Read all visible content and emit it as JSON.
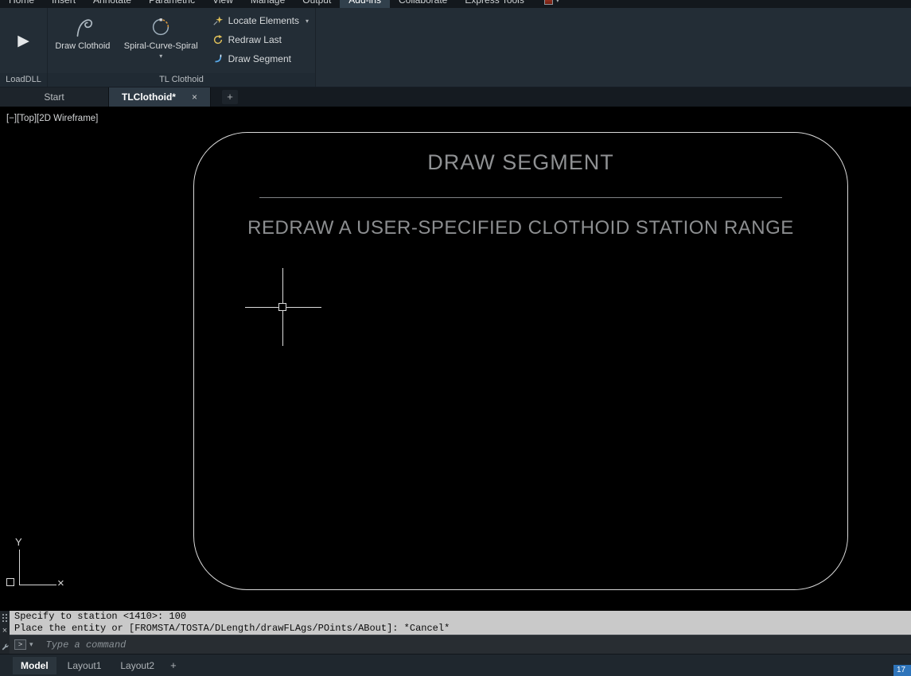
{
  "icons": {
    "play": "▶",
    "chevron_down": "▾",
    "close": "×",
    "plus": "+"
  },
  "menu": {
    "tabs": [
      {
        "label": "Home"
      },
      {
        "label": "Insert"
      },
      {
        "label": "Annotate"
      },
      {
        "label": "Parametric"
      },
      {
        "label": "View"
      },
      {
        "label": "Manage"
      },
      {
        "label": "Output"
      },
      {
        "label": "Add-ins"
      },
      {
        "label": "Collaborate"
      },
      {
        "label": "Express Tools"
      }
    ]
  },
  "ribbon": {
    "panels": [
      {
        "label": "LoadDLL"
      },
      {
        "label": "TL Clothoid"
      }
    ],
    "buttons": {
      "draw_clothoid": "Draw Clothoid",
      "spiral_curve_spiral": "Spiral-Curve-Spiral",
      "locate_elements": "Locate Elements",
      "redraw_last": "Redraw Last",
      "draw_segment": "Draw Segment"
    }
  },
  "file_tabs": {
    "start": "Start",
    "active": "TLClothoid*"
  },
  "viewport": {
    "controls": {
      "collapse": "[−]",
      "view": "[Top]",
      "visual_style": "[2D Wireframe]"
    },
    "ucs": {
      "y_label": "Y",
      "x_label": "×"
    }
  },
  "overlay": {
    "title": "DRAW SEGMENT",
    "subtitle": "REDRAW A USER-SPECIFIED CLOTHOID STATION RANGE"
  },
  "command": {
    "history": [
      "Specify to station <1410>: 100",
      "Place the entity or [FROMSTA/TOSTA/DLength/drawFLAgs/POints/ABout]: *Cancel*"
    ],
    "prompt_glyph": ">",
    "placeholder": "Type a command"
  },
  "status": {
    "model": "Model",
    "layout1": "Layout1",
    "layout2": "Layout2",
    "new_layout": "+",
    "tray_value": "17"
  },
  "colors": {
    "ribbon_bg": "#232d36",
    "canvas_bg": "#000000",
    "history_bg": "#c9c9c9",
    "accent_blue": "#2e74ba",
    "icon_yellow": "#e3c25a",
    "icon_blue": "#58a8e8",
    "overlay_text": "#8f9193"
  }
}
